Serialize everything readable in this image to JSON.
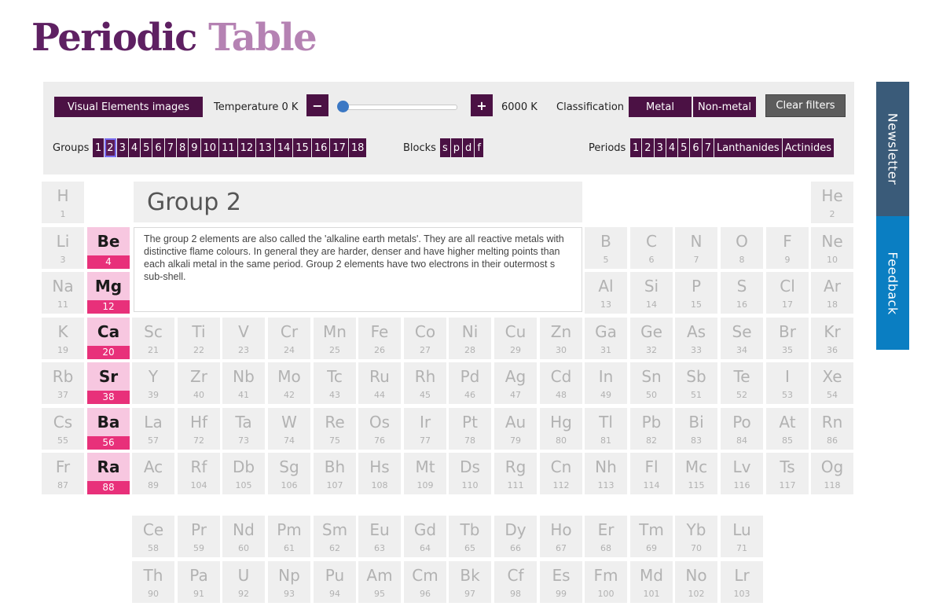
{
  "header": {
    "title_part1": "Periodic",
    "title_part2": "Table"
  },
  "filters": {
    "visual_elements_label": "Visual Elements images",
    "temperature_label": "Temperature 0 K",
    "minus_label": "−",
    "plus_label": "+",
    "max_temp_label": "6000 K",
    "temperature_slider_value": 0,
    "classification_label": "Classification",
    "metal_label": "Metal",
    "nonmetal_label": "Non-metal",
    "clear_label": "Clear filters",
    "groups_label": "Groups",
    "groups": [
      "1",
      "2",
      "3",
      "4",
      "5",
      "6",
      "7",
      "8",
      "9",
      "10",
      "11",
      "12",
      "13",
      "14",
      "15",
      "16",
      "17",
      "18"
    ],
    "selected_group": "2",
    "blocks_label": "Blocks",
    "blocks": [
      "s",
      "p",
      "d",
      "f"
    ],
    "periods_label": "Periods",
    "periods": [
      "1",
      "2",
      "3",
      "4",
      "5",
      "6",
      "7",
      "Lanthanides",
      "Actinides"
    ]
  },
  "info": {
    "title": "Group 2",
    "description": "The group 2 elements are also called the 'alkaline earth metals'. They are all reactive metals with distinctive flame colours. In general they are harder, denser and have higher melting points than each alkali metal in the same period. Group 2 elements have two electrons in their outermost s sub-shell."
  },
  "side_tabs": {
    "newsletter": "Newsletter",
    "feedback": "Feedback"
  },
  "colors": {
    "brand_dark": "#5e2062",
    "brand_light": "#b582b3",
    "button_bg": "#4b1144",
    "highlight_bg": "#f7c7e0",
    "highlight_num": "#e8307a",
    "newsletter_tab": "#3a5b79",
    "feedback_tab": "#0a7ec2"
  },
  "elements": [
    {
      "symbol": "H",
      "number": 1,
      "period": 1,
      "group": 1
    },
    {
      "symbol": "He",
      "number": 2,
      "period": 1,
      "group": 18
    },
    {
      "symbol": "Li",
      "number": 3,
      "period": 2,
      "group": 1
    },
    {
      "symbol": "Be",
      "number": 4,
      "period": 2,
      "group": 2,
      "highlighted": true
    },
    {
      "symbol": "B",
      "number": 5,
      "period": 2,
      "group": 13
    },
    {
      "symbol": "C",
      "number": 6,
      "period": 2,
      "group": 14
    },
    {
      "symbol": "N",
      "number": 7,
      "period": 2,
      "group": 15
    },
    {
      "symbol": "O",
      "number": 8,
      "period": 2,
      "group": 16
    },
    {
      "symbol": "F",
      "number": 9,
      "period": 2,
      "group": 17
    },
    {
      "symbol": "Ne",
      "number": 10,
      "period": 2,
      "group": 18
    },
    {
      "symbol": "Na",
      "number": 11,
      "period": 3,
      "group": 1
    },
    {
      "symbol": "Mg",
      "number": 12,
      "period": 3,
      "group": 2,
      "highlighted": true
    },
    {
      "symbol": "Al",
      "number": 13,
      "period": 3,
      "group": 13
    },
    {
      "symbol": "Si",
      "number": 14,
      "period": 3,
      "group": 14
    },
    {
      "symbol": "P",
      "number": 15,
      "period": 3,
      "group": 15
    },
    {
      "symbol": "S",
      "number": 16,
      "period": 3,
      "group": 16
    },
    {
      "symbol": "Cl",
      "number": 17,
      "period": 3,
      "group": 17
    },
    {
      "symbol": "Ar",
      "number": 18,
      "period": 3,
      "group": 18
    },
    {
      "symbol": "K",
      "number": 19,
      "period": 4,
      "group": 1
    },
    {
      "symbol": "Ca",
      "number": 20,
      "period": 4,
      "group": 2,
      "highlighted": true
    },
    {
      "symbol": "Sc",
      "number": 21,
      "period": 4,
      "group": 3
    },
    {
      "symbol": "Ti",
      "number": 22,
      "period": 4,
      "group": 4
    },
    {
      "symbol": "V",
      "number": 23,
      "period": 4,
      "group": 5
    },
    {
      "symbol": "Cr",
      "number": 24,
      "period": 4,
      "group": 6
    },
    {
      "symbol": "Mn",
      "number": 25,
      "period": 4,
      "group": 7
    },
    {
      "symbol": "Fe",
      "number": 26,
      "period": 4,
      "group": 8
    },
    {
      "symbol": "Co",
      "number": 27,
      "period": 4,
      "group": 9
    },
    {
      "symbol": "Ni",
      "number": 28,
      "period": 4,
      "group": 10
    },
    {
      "symbol": "Cu",
      "number": 29,
      "period": 4,
      "group": 11
    },
    {
      "symbol": "Zn",
      "number": 30,
      "period": 4,
      "group": 12
    },
    {
      "symbol": "Ga",
      "number": 31,
      "period": 4,
      "group": 13
    },
    {
      "symbol": "Ge",
      "number": 32,
      "period": 4,
      "group": 14
    },
    {
      "symbol": "As",
      "number": 33,
      "period": 4,
      "group": 15
    },
    {
      "symbol": "Se",
      "number": 34,
      "period": 4,
      "group": 16
    },
    {
      "symbol": "Br",
      "number": 35,
      "period": 4,
      "group": 17
    },
    {
      "symbol": "Kr",
      "number": 36,
      "period": 4,
      "group": 18
    },
    {
      "symbol": "Rb",
      "number": 37,
      "period": 5,
      "group": 1
    },
    {
      "symbol": "Sr",
      "number": 38,
      "period": 5,
      "group": 2,
      "highlighted": true
    },
    {
      "symbol": "Y",
      "number": 39,
      "period": 5,
      "group": 3
    },
    {
      "symbol": "Zr",
      "number": 40,
      "period": 5,
      "group": 4
    },
    {
      "symbol": "Nb",
      "number": 41,
      "period": 5,
      "group": 5
    },
    {
      "symbol": "Mo",
      "number": 42,
      "period": 5,
      "group": 6
    },
    {
      "symbol": "Tc",
      "number": 43,
      "period": 5,
      "group": 7
    },
    {
      "symbol": "Ru",
      "number": 44,
      "period": 5,
      "group": 8
    },
    {
      "symbol": "Rh",
      "number": 45,
      "period": 5,
      "group": 9
    },
    {
      "symbol": "Pd",
      "number": 46,
      "period": 5,
      "group": 10
    },
    {
      "symbol": "Ag",
      "number": 47,
      "period": 5,
      "group": 11
    },
    {
      "symbol": "Cd",
      "number": 48,
      "period": 5,
      "group": 12
    },
    {
      "symbol": "In",
      "number": 49,
      "period": 5,
      "group": 13
    },
    {
      "symbol": "Sn",
      "number": 50,
      "period": 5,
      "group": 14
    },
    {
      "symbol": "Sb",
      "number": 51,
      "period": 5,
      "group": 15
    },
    {
      "symbol": "Te",
      "number": 52,
      "period": 5,
      "group": 16
    },
    {
      "symbol": "I",
      "number": 53,
      "period": 5,
      "group": 17
    },
    {
      "symbol": "Xe",
      "number": 54,
      "period": 5,
      "group": 18
    },
    {
      "symbol": "Cs",
      "number": 55,
      "period": 6,
      "group": 1
    },
    {
      "symbol": "Ba",
      "number": 56,
      "period": 6,
      "group": 2,
      "highlighted": true
    },
    {
      "symbol": "La",
      "number": 57,
      "period": 6,
      "group": 3
    },
    {
      "symbol": "Hf",
      "number": 72,
      "period": 6,
      "group": 4
    },
    {
      "symbol": "Ta",
      "number": 73,
      "period": 6,
      "group": 5
    },
    {
      "symbol": "W",
      "number": 74,
      "period": 6,
      "group": 6
    },
    {
      "symbol": "Re",
      "number": 75,
      "period": 6,
      "group": 7
    },
    {
      "symbol": "Os",
      "number": 76,
      "period": 6,
      "group": 8
    },
    {
      "symbol": "Ir",
      "number": 77,
      "period": 6,
      "group": 9
    },
    {
      "symbol": "Pt",
      "number": 78,
      "period": 6,
      "group": 10
    },
    {
      "symbol": "Au",
      "number": 79,
      "period": 6,
      "group": 11
    },
    {
      "symbol": "Hg",
      "number": 80,
      "period": 6,
      "group": 12
    },
    {
      "symbol": "Tl",
      "number": 81,
      "period": 6,
      "group": 13
    },
    {
      "symbol": "Pb",
      "number": 82,
      "period": 6,
      "group": 14
    },
    {
      "symbol": "Bi",
      "number": 83,
      "period": 6,
      "group": 15
    },
    {
      "symbol": "Po",
      "number": 84,
      "period": 6,
      "group": 16
    },
    {
      "symbol": "At",
      "number": 85,
      "period": 6,
      "group": 17
    },
    {
      "symbol": "Rn",
      "number": 86,
      "period": 6,
      "group": 18
    },
    {
      "symbol": "Fr",
      "number": 87,
      "period": 7,
      "group": 1
    },
    {
      "symbol": "Ra",
      "number": 88,
      "period": 7,
      "group": 2,
      "highlighted": true
    },
    {
      "symbol": "Ac",
      "number": 89,
      "period": 7,
      "group": 3
    },
    {
      "symbol": "Rf",
      "number": 104,
      "period": 7,
      "group": 4
    },
    {
      "symbol": "Db",
      "number": 105,
      "period": 7,
      "group": 5
    },
    {
      "symbol": "Sg",
      "number": 106,
      "period": 7,
      "group": 6
    },
    {
      "symbol": "Bh",
      "number": 107,
      "period": 7,
      "group": 7
    },
    {
      "symbol": "Hs",
      "number": 108,
      "period": 7,
      "group": 8
    },
    {
      "symbol": "Mt",
      "number": 109,
      "period": 7,
      "group": 9
    },
    {
      "symbol": "Ds",
      "number": 110,
      "period": 7,
      "group": 10
    },
    {
      "symbol": "Rg",
      "number": 111,
      "period": 7,
      "group": 11
    },
    {
      "symbol": "Cn",
      "number": 112,
      "period": 7,
      "group": 12
    },
    {
      "symbol": "Nh",
      "number": 113,
      "period": 7,
      "group": 13
    },
    {
      "symbol": "Fl",
      "number": 114,
      "period": 7,
      "group": 14
    },
    {
      "symbol": "Mc",
      "number": 115,
      "period": 7,
      "group": 15
    },
    {
      "symbol": "Lv",
      "number": 116,
      "period": 7,
      "group": 16
    },
    {
      "symbol": "Ts",
      "number": 117,
      "period": 7,
      "group": 17
    },
    {
      "symbol": "Og",
      "number": 118,
      "period": 7,
      "group": 18
    },
    {
      "symbol": "Ce",
      "number": 58,
      "period": "Lanthanides",
      "group": null
    },
    {
      "symbol": "Pr",
      "number": 59,
      "period": "Lanthanides",
      "group": null
    },
    {
      "symbol": "Nd",
      "number": 60,
      "period": "Lanthanides",
      "group": null
    },
    {
      "symbol": "Pm",
      "number": 61,
      "period": "Lanthanides",
      "group": null
    },
    {
      "symbol": "Sm",
      "number": 62,
      "period": "Lanthanides",
      "group": null
    },
    {
      "symbol": "Eu",
      "number": 63,
      "period": "Lanthanides",
      "group": null
    },
    {
      "symbol": "Gd",
      "number": 64,
      "period": "Lanthanides",
      "group": null
    },
    {
      "symbol": "Tb",
      "number": 65,
      "period": "Lanthanides",
      "group": null
    },
    {
      "symbol": "Dy",
      "number": 66,
      "period": "Lanthanides",
      "group": null
    },
    {
      "symbol": "Ho",
      "number": 67,
      "period": "Lanthanides",
      "group": null
    },
    {
      "symbol": "Er",
      "number": 68,
      "period": "Lanthanides",
      "group": null
    },
    {
      "symbol": "Tm",
      "number": 69,
      "period": "Lanthanides",
      "group": null
    },
    {
      "symbol": "Yb",
      "number": 70,
      "period": "Lanthanides",
      "group": null
    },
    {
      "symbol": "Lu",
      "number": 71,
      "period": "Lanthanides",
      "group": null
    },
    {
      "symbol": "Th",
      "number": 90,
      "period": "Actinides",
      "group": null
    },
    {
      "symbol": "Pa",
      "number": 91,
      "period": "Actinides",
      "group": null
    },
    {
      "symbol": "U",
      "number": 92,
      "period": "Actinides",
      "group": null
    },
    {
      "symbol": "Np",
      "number": 93,
      "period": "Actinides",
      "group": null
    },
    {
      "symbol": "Pu",
      "number": 94,
      "period": "Actinides",
      "group": null
    },
    {
      "symbol": "Am",
      "number": 95,
      "period": "Actinides",
      "group": null
    },
    {
      "symbol": "Cm",
      "number": 96,
      "period": "Actinides",
      "group": null
    },
    {
      "symbol": "Bk",
      "number": 97,
      "period": "Actinides",
      "group": null
    },
    {
      "symbol": "Cf",
      "number": 98,
      "period": "Actinides",
      "group": null
    },
    {
      "symbol": "Es",
      "number": 99,
      "period": "Actinides",
      "group": null
    },
    {
      "symbol": "Fm",
      "number": 100,
      "period": "Actinides",
      "group": null
    },
    {
      "symbol": "Md",
      "number": 101,
      "period": "Actinides",
      "group": null
    },
    {
      "symbol": "No",
      "number": 102,
      "period": "Actinides",
      "group": null
    },
    {
      "symbol": "Lr",
      "number": 103,
      "period": "Actinides",
      "group": null
    }
  ]
}
